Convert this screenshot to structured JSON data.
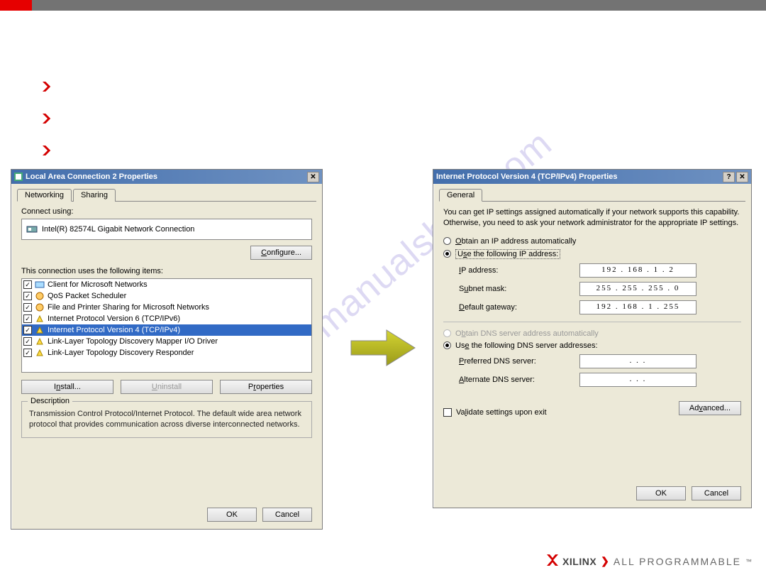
{
  "dialog1": {
    "title": "Local Area Connection 2 Properties",
    "tabs": [
      "Networking",
      "Sharing"
    ],
    "active_tab": 0,
    "connect_using_label": "Connect using:",
    "adapter": "Intel(R) 82574L Gigabit Network Connection",
    "configure_btn": "Configure...",
    "items_label": "This connection uses the following items:",
    "items": [
      {
        "checked": true,
        "icon": "client-icon",
        "label": "Client for Microsoft Networks"
      },
      {
        "checked": true,
        "icon": "service-icon",
        "label": "QoS Packet Scheduler"
      },
      {
        "checked": true,
        "icon": "service-icon",
        "label": "File and Printer Sharing for Microsoft Networks"
      },
      {
        "checked": true,
        "icon": "protocol-icon",
        "label": "Internet Protocol Version 6 (TCP/IPv6)"
      },
      {
        "checked": true,
        "icon": "protocol-icon",
        "label": "Internet Protocol Version 4 (TCP/IPv4)",
        "selected": true
      },
      {
        "checked": true,
        "icon": "protocol-icon",
        "label": "Link-Layer Topology Discovery Mapper I/O Driver"
      },
      {
        "checked": true,
        "icon": "protocol-icon",
        "label": "Link-Layer Topology Discovery Responder"
      }
    ],
    "install_btn": "Install...",
    "uninstall_btn": "Uninstall",
    "properties_btn": "Properties",
    "description_title": "Description",
    "description_text": "Transmission Control Protocol/Internet Protocol. The default wide area network protocol that provides communication across diverse interconnected networks.",
    "ok_btn": "OK",
    "cancel_btn": "Cancel"
  },
  "dialog2": {
    "title": "Internet Protocol Version 4 (TCP/IPv4) Properties",
    "tab": "General",
    "info_text": "You can get IP settings assigned automatically if your network supports this capability. Otherwise, you need to ask your network administrator for the appropriate IP settings.",
    "radio_auto_ip": "Obtain an IP address automatically",
    "radio_use_ip": "Use the following IP address:",
    "ip_label": "IP address:",
    "ip_value": "192 . 168 .  1  .  2",
    "subnet_label": "Subnet mask:",
    "subnet_value": "255 . 255 . 255 .  0",
    "gateway_label": "Default gateway:",
    "gateway_value": "192 . 168 .  1  . 255",
    "radio_auto_dns": "Obtain DNS server address automatically",
    "radio_use_dns": "Use the following DNS server addresses:",
    "pref_dns_label": "Preferred DNS server:",
    "pref_dns_value": " .    .    . ",
    "alt_dns_label": "Alternate DNS server:",
    "alt_dns_value": " .    .    . ",
    "validate_label": "Validate settings upon exit",
    "advanced_btn": "Advanced...",
    "ok_btn": "OK",
    "cancel_btn": "Cancel"
  },
  "brand": {
    "x": "XILINX",
    "ap": "ALL PROGRAMMABLE"
  }
}
